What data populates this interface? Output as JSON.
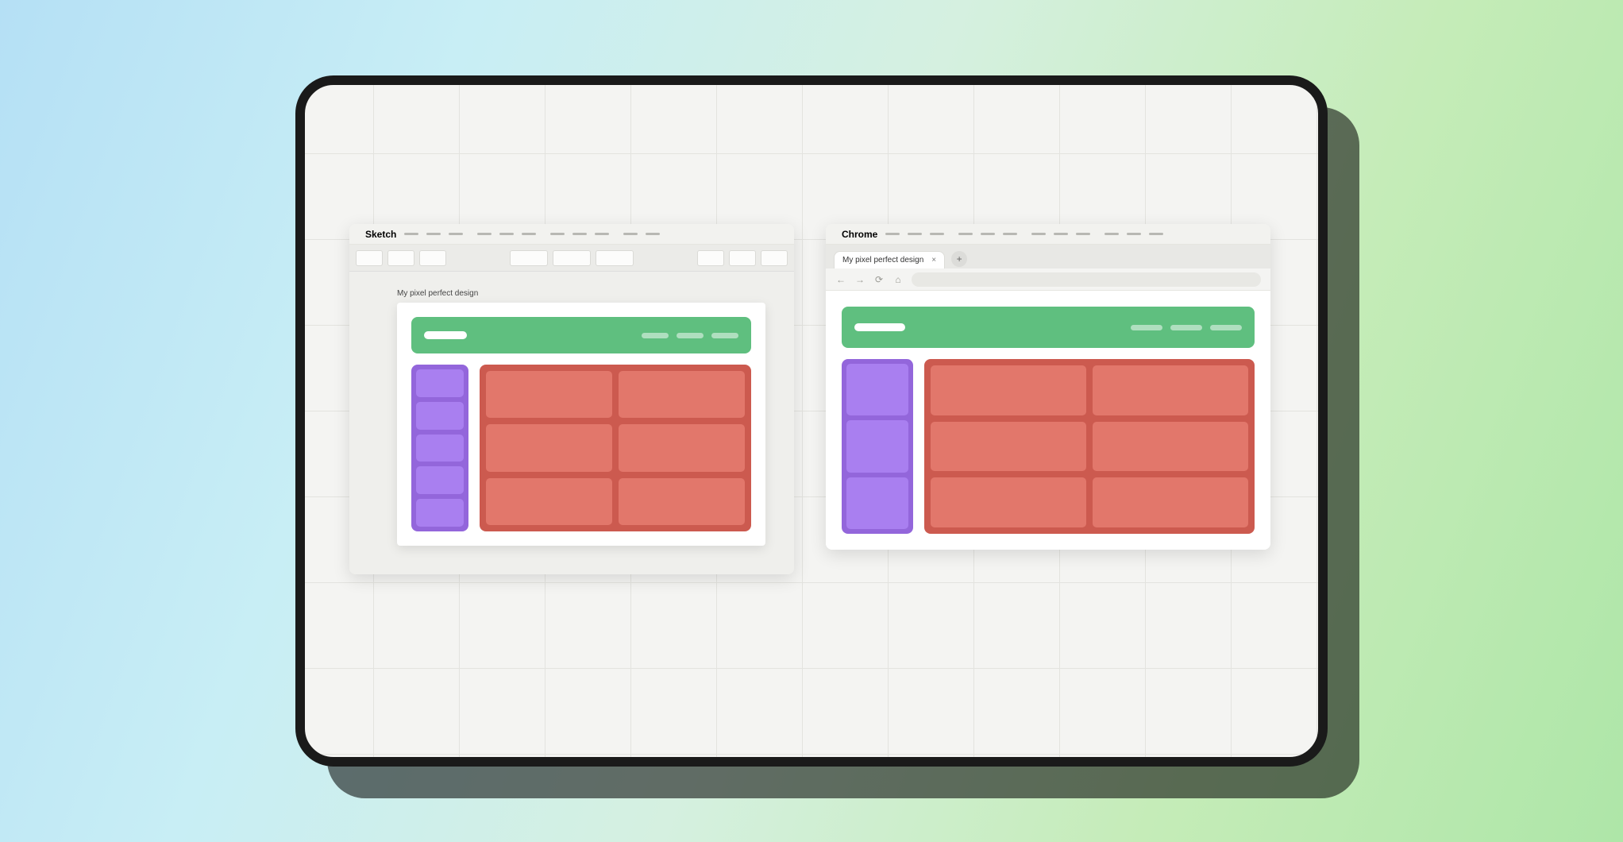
{
  "sketch": {
    "app_name": "Sketch",
    "artboard_label": "My pixel perfect design"
  },
  "chrome": {
    "app_name": "Chrome",
    "tab_title": "My pixel perfect design",
    "tab_close": "×",
    "new_tab": "+"
  },
  "colors": {
    "green": "#5fbf7f",
    "purple": "#9366db",
    "red": "#cc5a4f"
  }
}
